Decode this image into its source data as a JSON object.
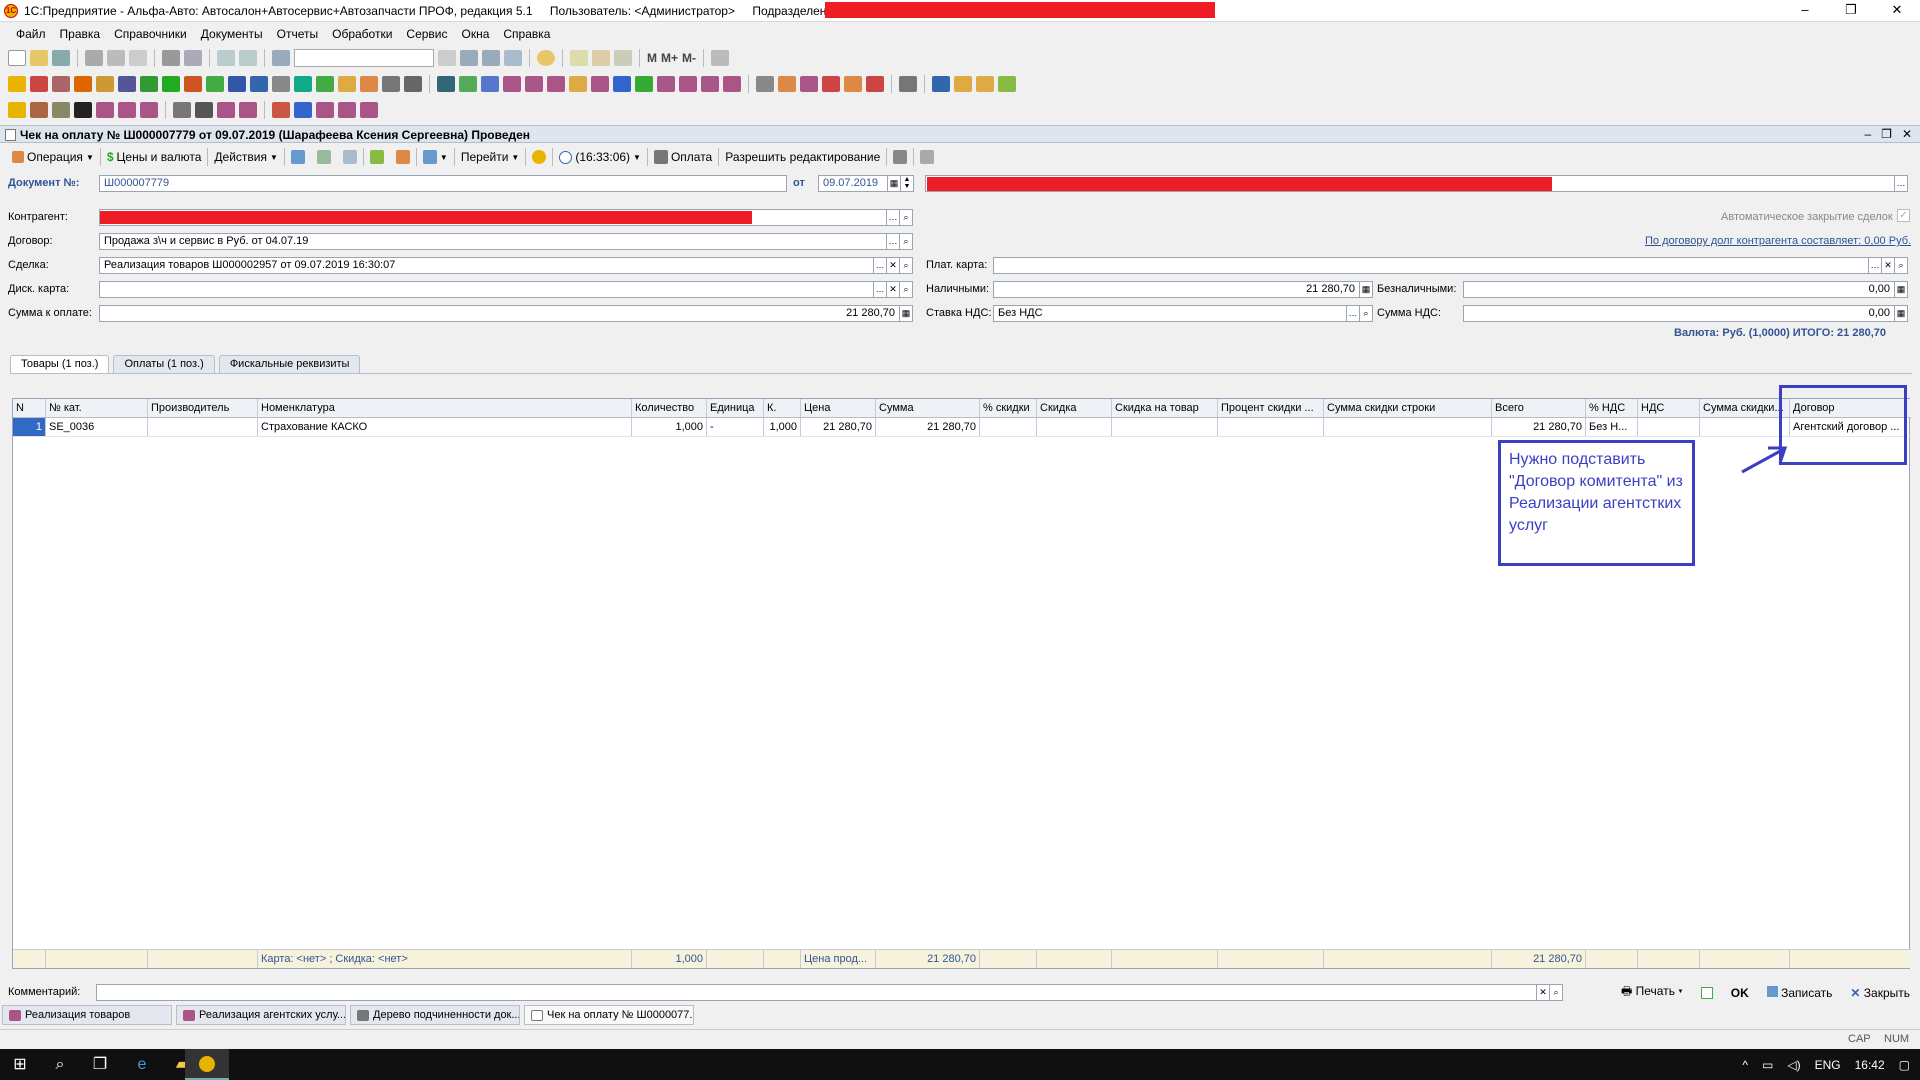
{
  "window": {
    "title": "1С:Предприятие - Альфа-Авто: Автосалон+Автосервис+Автозапчасти ПРОФ, редакция 5.1",
    "user_label": "Пользователь: <Администратор>",
    "dept_label": "Подразделение:",
    "controls": {
      "minimize": "–",
      "restore": "❐",
      "close": "✕"
    }
  },
  "menu": [
    "Файл",
    "Правка",
    "Справочники",
    "Документы",
    "Отчеты",
    "Обработки",
    "Сервис",
    "Окна",
    "Справка"
  ],
  "toolbar": {
    "m": "M",
    "mplus": "M+",
    "mminus": "M-"
  },
  "document": {
    "title": "Чек на оплату № Ш000007779 от 09.07.2019 (Шарафеева Ксения Сергеевна) Проведен",
    "toolbar": {
      "operation": "Операция",
      "prices": "Цены и валюта",
      "actions": "Действия",
      "goto": "Перейти",
      "time": "(16:33:06)",
      "payment": "Оплата",
      "allow_edit": "Разрешить редактирование"
    },
    "number_label": "Документ №:",
    "number_value": "Ш000007779",
    "date_label": "от",
    "date_value": "09.07.2019",
    "counterparty_label": "Контрагент:",
    "contract_label": "Договор:",
    "contract_value": "Продажа з\\ч и сервис в Руб. от 04.07.19",
    "deal_label": "Сделка:",
    "deal_value": "Реализация товаров Ш000002957 от 09.07.2019 16:30:07",
    "disc_label": "Диск. карта:",
    "disc_value": "",
    "sum_label": "Сумма к оплате:",
    "sum_value": "21 280,70",
    "autoclose_label": "Автоматическое закрытие сделок",
    "debt_link": "По договору долг контрагента составляет: 0,00 Руб.",
    "pay_card_label": "Плат. карта:",
    "pay_card_value": "",
    "cash_label": "Наличными:",
    "cash_value": "21 280,70",
    "noncash_label": "Безналичными:",
    "noncash_value": "0,00",
    "vat_rate_label": "Ставка НДС:",
    "vat_rate_value": "Без НДС",
    "vat_sum_label": "Сумма НДС:",
    "vat_sum_value": "0,00",
    "currency_total": "Валюта: Руб. (1,0000) ИТОГО: 21 280,70"
  },
  "tabs": [
    "Товары (1 поз.)",
    "Оплаты (1 поз.)",
    "Фискальные реквизиты"
  ],
  "grid": {
    "columns": [
      "N",
      "№ кат.",
      "Производитель",
      "Номенклатура",
      "Количество",
      "Единица",
      "К.",
      "Цена",
      "Сумма",
      "% скидки",
      "Скидка",
      "Скидка на товар",
      "Процент скидки ...",
      "Сумма скидки строки",
      "Всего",
      "% НДС",
      "НДС",
      "Сумма скидки...",
      "Договор"
    ],
    "rows": [
      [
        "1",
        "SE_0036",
        "",
        "Страхование КАСКО",
        "1,000",
        "-",
        "1,000",
        "21 280,70",
        "21 280,70",
        "",
        "",
        "",
        "",
        "",
        "21 280,70",
        "Без Н...",
        "",
        "",
        "Агентский договор ..."
      ]
    ],
    "footer": [
      "",
      "",
      "",
      "Карта: <нет> ; Скидка: <нет>",
      "1,000",
      "",
      "",
      "Цена прод...",
      "21 280,70",
      "",
      "",
      "",
      "",
      "",
      "21 280,70",
      "",
      "",
      "",
      ""
    ]
  },
  "annotation": "Нужно подставить \"Договор комитента\" из Реализации агентстких услуг",
  "comment_label": "Комментарий:",
  "bottom_buttons": {
    "print": "Печать",
    "ok": "OK",
    "save": "Записать",
    "close": "Закрыть"
  },
  "window_tabs": [
    "Реализация товаров",
    "Реализация агентских услу...",
    "Дерево подчиненности док...",
    "Чек на оплату № Ш0000077..."
  ],
  "status": {
    "cap": "CAP",
    "num": "NUM"
  },
  "taskbar": {
    "lang": "ENG",
    "time": "16:42"
  }
}
